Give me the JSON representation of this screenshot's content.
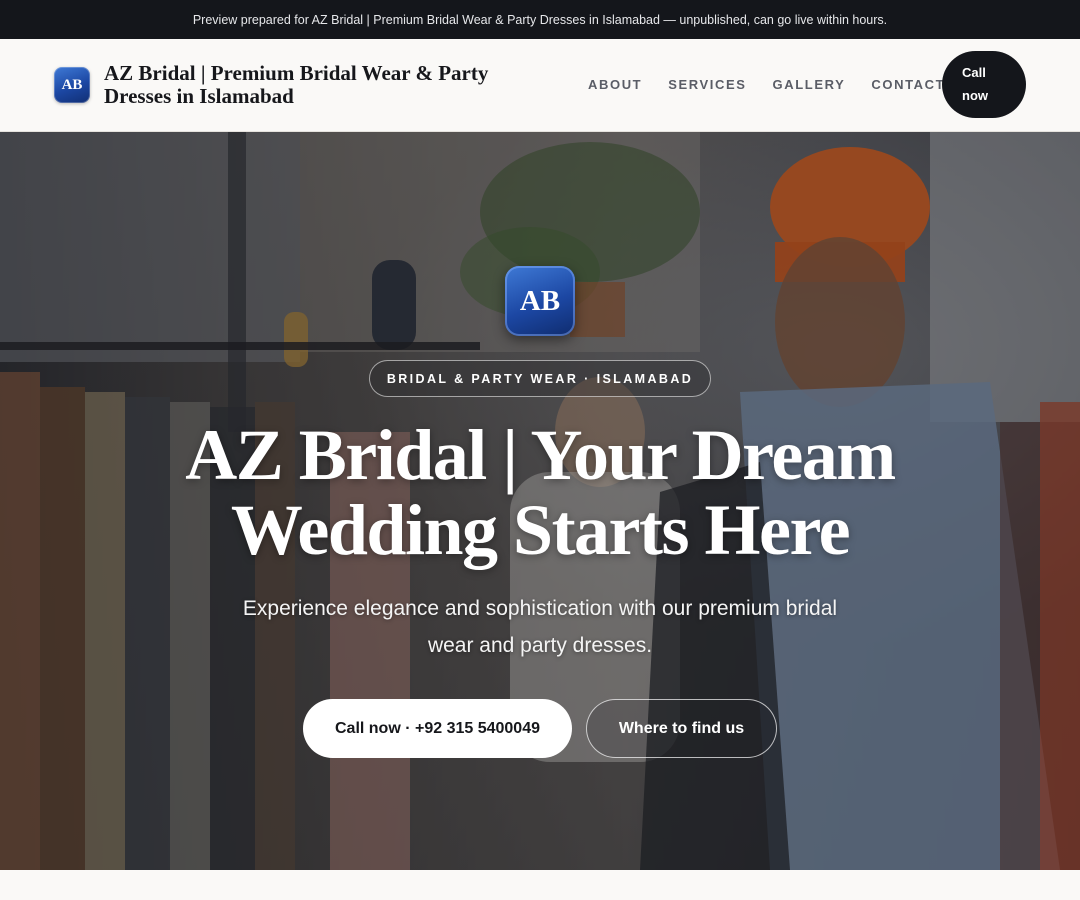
{
  "topbar": {
    "notice": "Preview prepared for AZ Bridal | Premium Bridal Wear & Party Dresses in Islamabad — unpublished, can go live within hours."
  },
  "header": {
    "logo_text": "AB",
    "brand_name": "AZ Bridal | Premium Bridal Wear & Party Dresses in Islamabad",
    "nav": [
      {
        "label": "ABOUT"
      },
      {
        "label": "SERVICES"
      },
      {
        "label": "GALLERY"
      },
      {
        "label": "CONTACT"
      }
    ],
    "cta_line1": "Call",
    "cta_line2": "now"
  },
  "hero": {
    "logo_text": "AB",
    "tagline": "BRIDAL & PARTY WEAR · ISLAMABAD",
    "title_line1": "AZ Bridal | Your Dream",
    "title_line2": "Wedding Starts Here",
    "subtitle": "Experience elegance and sophistication with our premium bridal wear and party dresses.",
    "primary_button": "Call now · +92 315 5400049",
    "secondary_button": "Where to find us"
  },
  "colors": {
    "topbar_bg": "#14161b",
    "brand_blue": "#1c47a3",
    "header_bg": "#faf9f7",
    "hat_orange": "#e0631f"
  }
}
